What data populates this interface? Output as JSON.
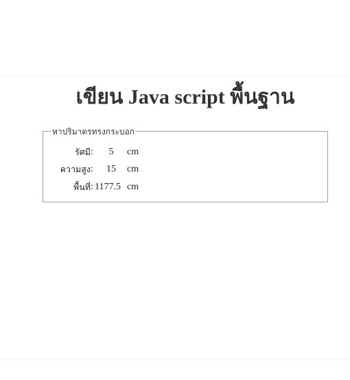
{
  "page": {
    "title": "เขียน Java script พื้นฐาน"
  },
  "form": {
    "legend": "หาปริมาตรทรงกระบอก",
    "rows": [
      {
        "label": "รัศมี",
        "colon": ":",
        "value": "5",
        "unit": "cm"
      },
      {
        "label": "ความสูง",
        "colon": ":",
        "value": "15",
        "unit": "cm"
      },
      {
        "label": "พื้นที่",
        "colon": ":",
        "value": "1177.5",
        "unit": "cm"
      }
    ]
  }
}
